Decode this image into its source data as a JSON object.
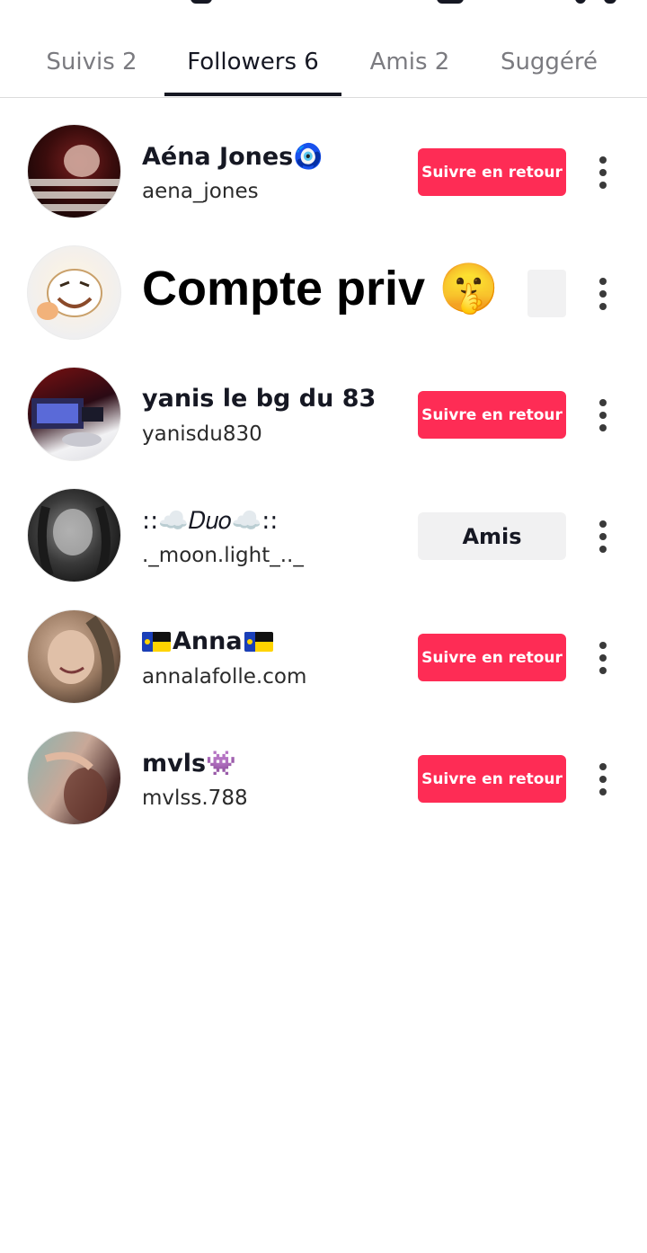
{
  "tabs": [
    {
      "label": "Suivis 2",
      "active": false
    },
    {
      "label": "Followers 6",
      "active": true
    },
    {
      "label": "Amis 2",
      "active": false
    },
    {
      "label": "Suggéré",
      "active": false
    }
  ],
  "rows": [
    {
      "name": "Aéna Jones🧿",
      "handle": "aena_jones",
      "button": "Suivre en retour",
      "button_style": "red"
    },
    {
      "private_title": "Compte priv 🤫"
    },
    {
      "name": "yanis le bg du 83",
      "handle": "yanisdu830",
      "button": "Suivre en retour",
      "button_style": "red"
    },
    {
      "name": "::☁️𝐷𝑢𝑜☁️::",
      "handle": "._moon.light_.._",
      "button": "Amis",
      "button_style": "grey"
    },
    {
      "name": "Anna",
      "handle": "annalafolle.com",
      "button": "Suivre en retour",
      "button_style": "red"
    },
    {
      "name": "mvls👾",
      "handle": "mvlss.788",
      "button": "Suivre en retour",
      "button_style": "red"
    }
  ],
  "colors": {
    "accent": "#fe2c55",
    "secondary_button": "#f1f1f2",
    "text_primary": "#161823"
  },
  "icons": [
    "more-vertical-icon",
    "flag-icon"
  ]
}
